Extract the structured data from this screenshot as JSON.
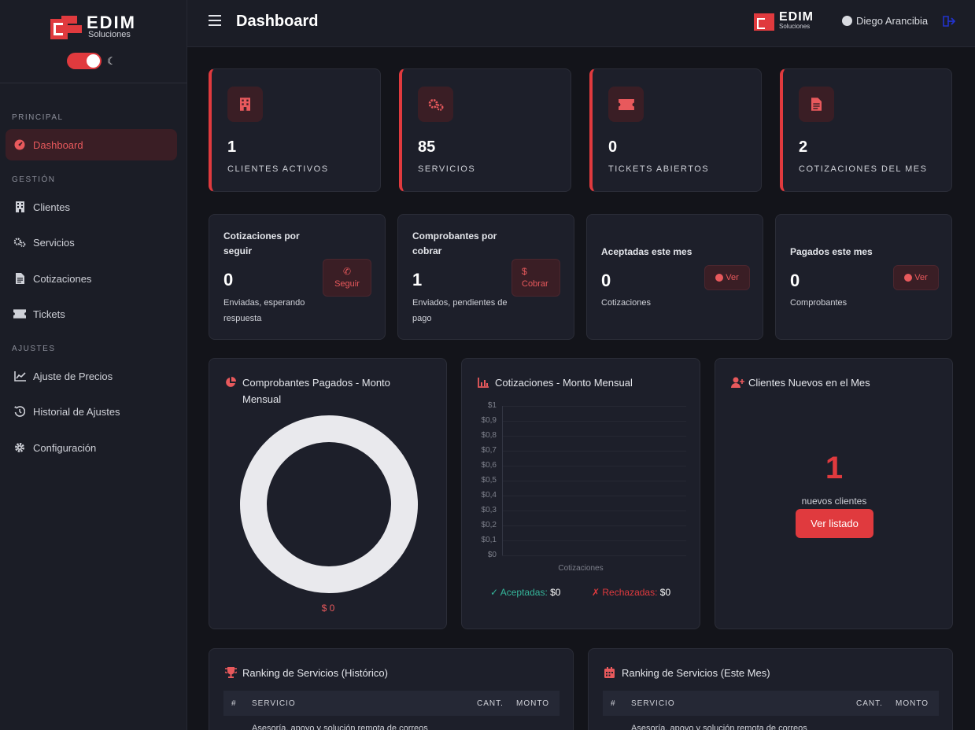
{
  "brand": {
    "name": "EDIM",
    "sub": "Soluciones"
  },
  "sidebar": {
    "sections": {
      "principal": "PRINCIPAL",
      "gestion": "GESTIÓN",
      "ajustes": "AJUSTES"
    },
    "items": [
      {
        "label": "Dashboard",
        "icon": "gauge-icon"
      },
      {
        "label": "Clientes",
        "icon": "building-icon"
      },
      {
        "label": "Servicios",
        "icon": "gears-icon"
      },
      {
        "label": "Cotizaciones",
        "icon": "document-icon"
      },
      {
        "label": "Tickets",
        "icon": "ticket-icon"
      },
      {
        "label": "Ajuste de Precios",
        "icon": "line-chart-icon"
      },
      {
        "label": "Historial de Ajustes",
        "icon": "history-icon"
      },
      {
        "label": "Configuración",
        "icon": "gear-icon"
      }
    ]
  },
  "header": {
    "title": "Dashboard",
    "user": "Diego Arancibia"
  },
  "stats": [
    {
      "value": "1",
      "label": "CLIENTES ACTIVOS",
      "icon": "building-icon"
    },
    {
      "value": "85",
      "label": "SERVICIOS",
      "icon": "gears-icon"
    },
    {
      "value": "0",
      "label": "TICKETS ABIERTOS",
      "icon": "ticket-icon"
    },
    {
      "value": "2",
      "label": "COTIZACIONES DEL MES",
      "icon": "document-icon"
    }
  ],
  "mini": [
    {
      "title": "Cotizaciones por seguir",
      "value": "0",
      "desc": "Enviadas, esperando respuesta",
      "button": "Seguir",
      "button_icon": "phone-icon"
    },
    {
      "title": "Comprobantes por cobrar",
      "value": "1",
      "desc": "Enviados, pendientes de pago",
      "button": "Cobrar",
      "button_icon": "dollar-icon"
    },
    {
      "title": "Aceptadas este mes",
      "value": "0",
      "desc": "Cotizaciones",
      "button": "Ver",
      "button_icon": "check-circle-icon"
    },
    {
      "title": "Pagados este mes",
      "value": "0",
      "desc": "Comprobantes",
      "button": "Ver",
      "button_icon": "check-circle-icon"
    }
  ],
  "charts": {
    "pagados": {
      "title": "Comprobantes Pagados - Monto Mensual",
      "total": "$ 0"
    },
    "cotizaciones": {
      "title": "Cotizaciones - Monto Mensual",
      "xlabel": "Cotizaciones",
      "legend_aceptadas": "Aceptadas:",
      "legend_aceptadas_val": "$0",
      "legend_rechazadas": "Rechazadas:",
      "legend_rechazadas_val": "$0"
    },
    "clientes": {
      "title": "Clientes Nuevos en el Mes",
      "value": "1",
      "caption": "nuevos clientes",
      "button": "Ver listado"
    }
  },
  "chart_data": {
    "type": "bar",
    "title": "Cotizaciones - Monto Mensual",
    "xlabel": "Cotizaciones",
    "ylabel": "",
    "ylim": [
      0,
      1
    ],
    "yticks": [
      "$1",
      "$0,9",
      "$0,8",
      "$0,7",
      "$0,6",
      "$0,5",
      "$0,4",
      "$0,3",
      "$0,2",
      "$0,1",
      "$0"
    ],
    "series": [
      {
        "name": "Aceptadas",
        "values": [
          0
        ]
      },
      {
        "name": "Rechazadas",
        "values": [
          0
        ]
      }
    ]
  },
  "ranking": {
    "historico_title": "Ranking de Servicios (Histórico)",
    "mes_title": "Ranking de Servicios (Este Mes)",
    "columns": [
      "#",
      "SERVICIO",
      "CANT.",
      "MONTO"
    ],
    "first_row": "Asesoría, apoyo y solución remota de correos"
  },
  "colors": {
    "accent": "#e03a3e",
    "bg": "#13141a",
    "card": "#1d1f2a",
    "success": "#35b59a"
  }
}
